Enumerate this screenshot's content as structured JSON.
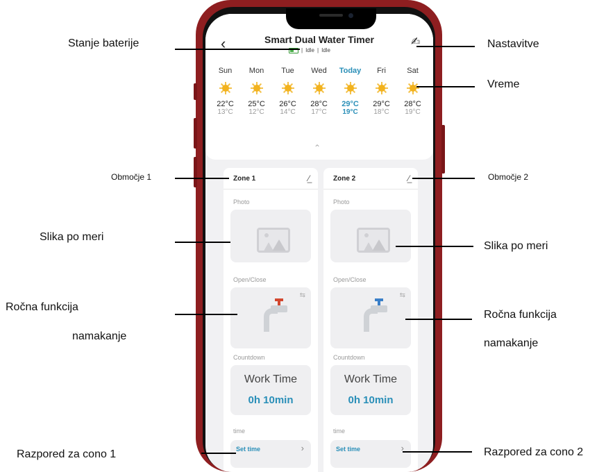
{
  "app": {
    "title": "Smart Dual Water Timer",
    "back_icon": "chevron-left-icon",
    "edit_icon": "pencil-icon",
    "status": [
      "Idle",
      "Idle"
    ]
  },
  "weather": {
    "days": [
      {
        "name": "Sun",
        "high": "22°C",
        "low": "13°C",
        "today": false
      },
      {
        "name": "Mon",
        "high": "25°C",
        "low": "12°C",
        "today": false
      },
      {
        "name": "Tue",
        "high": "26°C",
        "low": "14°C",
        "today": false
      },
      {
        "name": "Wed",
        "high": "28°C",
        "low": "17°C",
        "today": false
      },
      {
        "name": "Today",
        "high": "29°C",
        "low": "19°C",
        "today": true
      },
      {
        "name": "Fri",
        "high": "29°C",
        "low": "18°C",
        "today": false
      },
      {
        "name": "Sat",
        "high": "28°C",
        "low": "19°C",
        "today": false
      }
    ],
    "icon": "sun-icon"
  },
  "zones": [
    {
      "name": "Zone 1",
      "photo_label": "Photo",
      "open_close_label": "Open/Close",
      "countdown_label": "Countdown",
      "work_time_label": "Work Time",
      "duration": "0h 10min",
      "time_label": "time",
      "set_time_label": "Set time",
      "valve_color": "#d2472f"
    },
    {
      "name": "Zone 2",
      "photo_label": "Photo",
      "open_close_label": "Open/Close",
      "countdown_label": "Countdown",
      "work_time_label": "Work Time",
      "duration": "0h 10min",
      "time_label": "time",
      "set_time_label": "Set time",
      "valve_color": "#3a7fc8"
    }
  ],
  "annotations": {
    "battery": "Stanje baterije",
    "settings": "Nastavitve",
    "weather": "Vreme",
    "zone1": "Območje 1",
    "zone2": "Območje 2",
    "custom_image_left": "Slika po meri",
    "custom_image_right": "Slika po meri",
    "manual_left_1": "Ročna funkcija",
    "manual_left_2": "namakanje",
    "manual_right_1": "Ročna funkcija",
    "manual_right_2": "namakanje",
    "schedule_zone1": "Razpored za cono 1",
    "schedule_zone2": "Razpored za cono 2"
  },
  "colors": {
    "phone_frame": "#8e1e20",
    "accent": "#2a8fb8",
    "sun": "#f2b21e"
  }
}
